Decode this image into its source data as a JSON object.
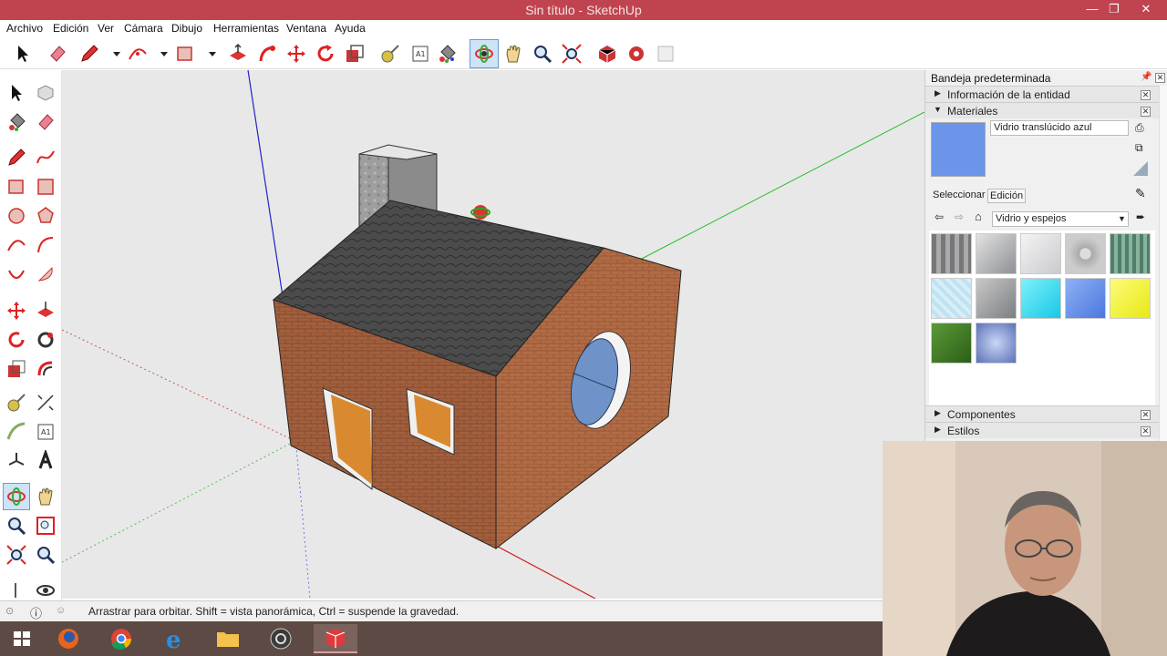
{
  "window": {
    "title": "Sin título - SketchUp",
    "controls": {
      "minimize": "—",
      "restore": "❐",
      "close": "✕"
    },
    "titlebar_color": "#c0444f"
  },
  "menu": {
    "items": [
      "Archivo",
      "Edición",
      "Ver",
      "Cámara",
      "Dibujo",
      "Herramientas",
      "Ventana",
      "Ayuda"
    ]
  },
  "toolbar": {
    "icons": [
      "select-icon",
      "eraser-icon",
      "pencil-icon",
      "dropdown",
      "arc-icon",
      "dropdown",
      "rectangle-icon",
      "dropdown",
      "push-pull-icon",
      "follow-me-icon",
      "move-icon",
      "rotate-icon",
      "scale-icon",
      "tape-measure-icon",
      "text-icon",
      "paint-bucket-icon",
      "orbit-icon",
      "pan-icon",
      "zoom-icon",
      "zoom-extents-icon",
      "3d-warehouse-icon",
      "extension-warehouse-icon",
      "layout-icon"
    ],
    "active": "orbit-icon"
  },
  "tray": {
    "title": "Bandeja predeterminada",
    "entity_info": "Información de la entidad",
    "materials": "Materiales",
    "material_name": "Vidrio translúcido azul",
    "tab_select": "Seleccionar",
    "tab_edit": "Edición",
    "collection": "Vidrio y espejos",
    "components": "Componentes",
    "styles": "Estilos",
    "swatch_colors": [
      "#8a8f96",
      "#b9bcc0",
      "#dcdde0",
      "#c9c9c9",
      "#5f8f78",
      "#d6eef8",
      "#9a9c9f",
      "#28d6f0",
      "#5b86e8",
      "#f2f230",
      "#3f7a28",
      "#6f85c8"
    ],
    "preview_color": "#6a95e8"
  },
  "status": {
    "text": "Arrastrar para orbitar. Shift = vista panorámica, Ctrl = suspende la gravedad."
  },
  "taskbar": {
    "apps": [
      "start-icon",
      "firefox-icon",
      "chrome-icon",
      "internet-explorer-icon",
      "file-explorer-icon",
      "obs-icon",
      "sketchup-icon"
    ]
  }
}
